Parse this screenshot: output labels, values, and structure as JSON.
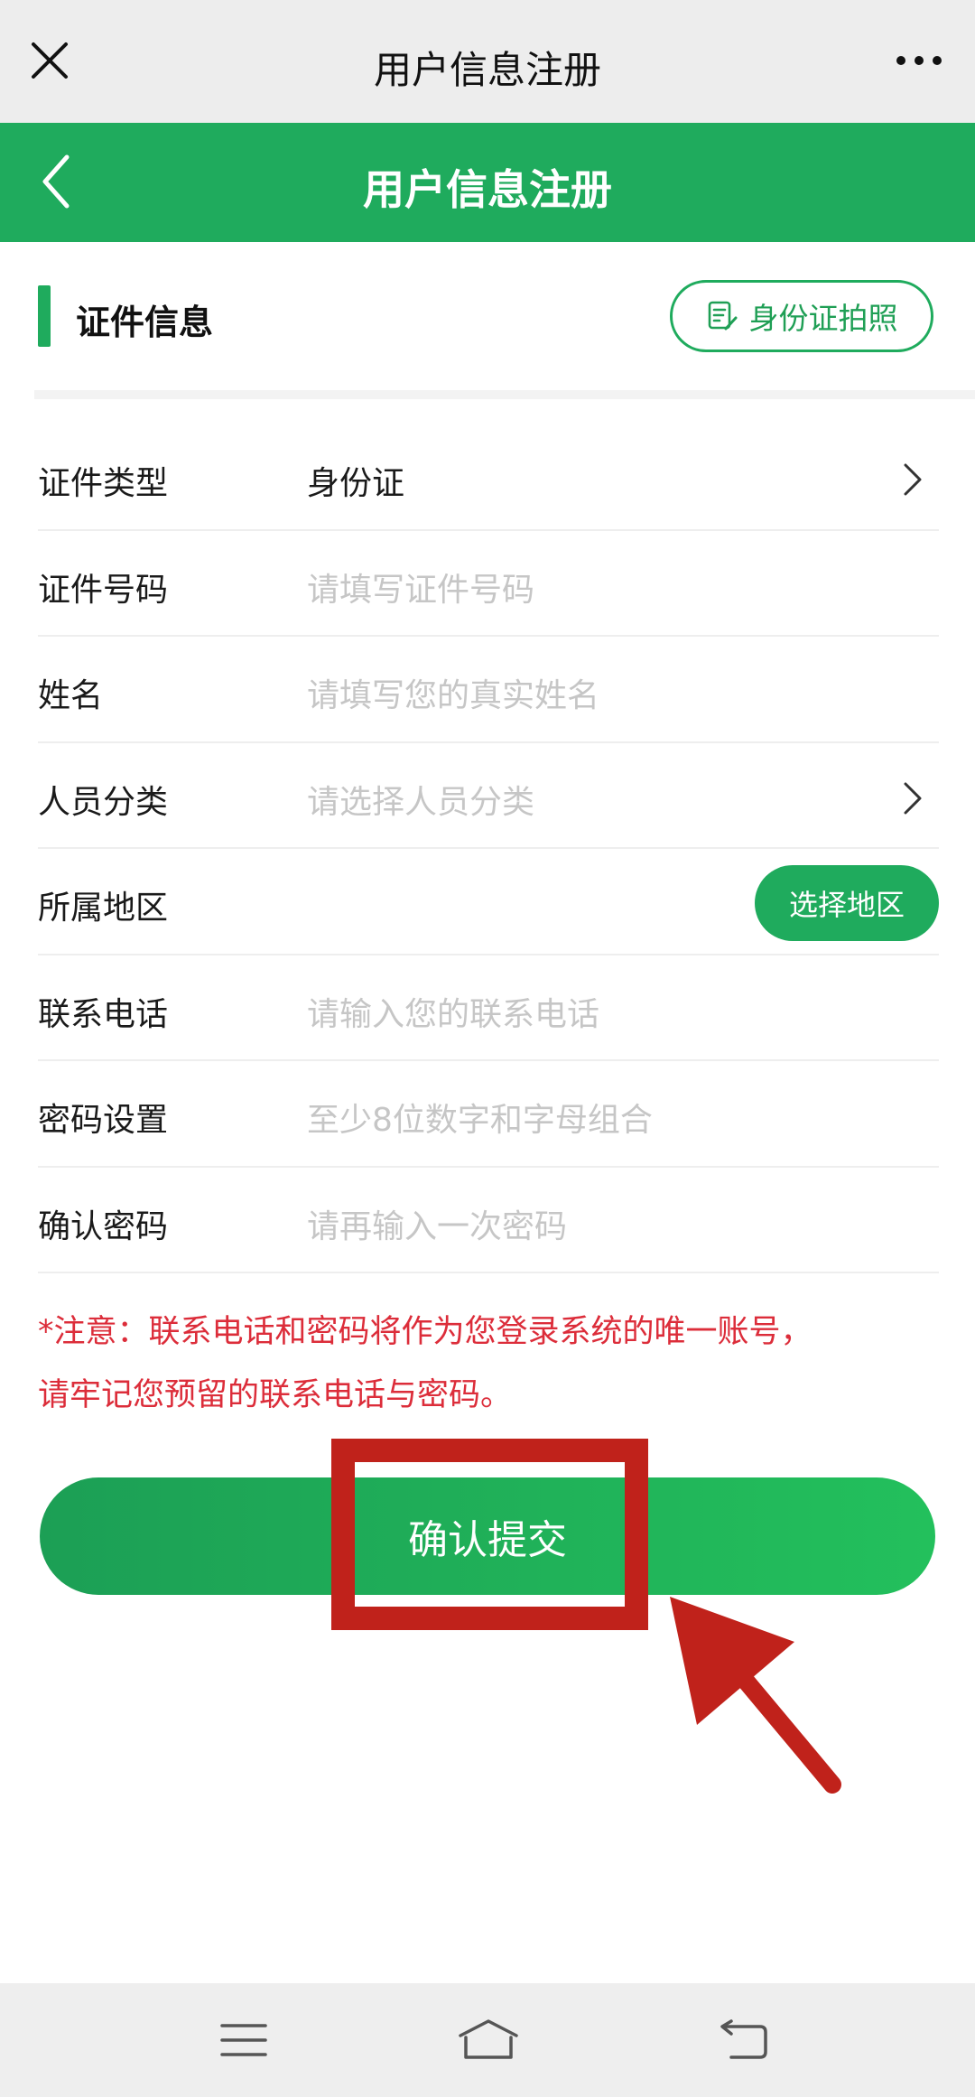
{
  "topbar": {
    "title": "用户信息注册"
  },
  "header": {
    "title": "用户信息注册"
  },
  "section": {
    "title": "证件信息",
    "photo_button": "身份证拍照"
  },
  "form": {
    "rows": [
      {
        "label": "证件类型",
        "value": "身份证",
        "placeholder": ""
      },
      {
        "label": "证件号码",
        "value": "",
        "placeholder": "请填写证件号码"
      },
      {
        "label": "姓名",
        "value": "",
        "placeholder": "请填写您的真实姓名"
      },
      {
        "label": "人员分类",
        "value": "",
        "placeholder": "请选择人员分类"
      },
      {
        "label": "所属地区",
        "value": "",
        "placeholder": "",
        "button": "选择地区"
      },
      {
        "label": "联系电话",
        "value": "",
        "placeholder": "请输入您的联系电话"
      },
      {
        "label": "密码设置",
        "value": "",
        "placeholder": "至少8位数字和字母组合"
      },
      {
        "label": "确认密码",
        "value": "",
        "placeholder": "请再输入一次密码"
      }
    ]
  },
  "notice": {
    "line1": "*注意：联系电话和密码将作为您登录系统的唯一账号，",
    "line2": "请牢记您预留的联系电话与密码。"
  },
  "submit": {
    "label": "确认提交"
  },
  "colors": {
    "primary": "#1fab5d",
    "warning": "#dc2d3a",
    "annotation": "#c0221b"
  },
  "icons": {
    "topbar_left": "close-icon",
    "topbar_right": "more-icon",
    "header_left": "back-icon",
    "photo_button": "document-icon",
    "row_chevron": "chevron-right-icon",
    "nav": [
      "menu-icon",
      "home-icon",
      "return-icon"
    ]
  }
}
